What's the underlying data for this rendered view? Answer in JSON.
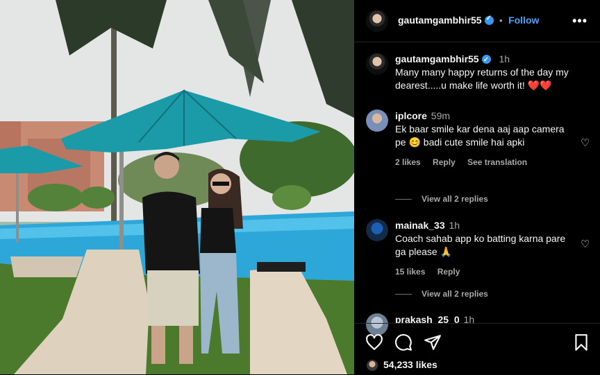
{
  "header": {
    "username": "gautamgambhir55",
    "separator": "•",
    "follow_label": "Follow",
    "more_icon": "more-horizontal-icon"
  },
  "caption": {
    "username": "gautamgambhir55",
    "time": "1h",
    "text": "Many many happy returns of the day my dearest.....u make life worth it! ❤️❤️"
  },
  "comments": [
    {
      "username": "iplcore",
      "time": "59m",
      "text": "Ek baar smile kar dena aaj aap camera pe 😊 badi cute smile hai apki",
      "likes": "2 likes",
      "reply": "Reply",
      "translate": "See translation",
      "view_replies": "View all 2 replies"
    },
    {
      "username": "mainak_33",
      "time": "1h",
      "text": "Coach sahab app ko batting karna pare ga please 🙏",
      "likes": "15 likes",
      "reply": "Reply",
      "view_replies": "View all 2 replies"
    },
    {
      "username": "prakash_25_0",
      "time": "1h"
    }
  ],
  "footer": {
    "likes": "54,233 likes",
    "icons": [
      "heart-icon",
      "comment-icon",
      "share-icon",
      "bookmark-icon"
    ]
  },
  "colors": {
    "link": "#4aa3ff",
    "verified": "#3897f0",
    "background": "#000000"
  }
}
